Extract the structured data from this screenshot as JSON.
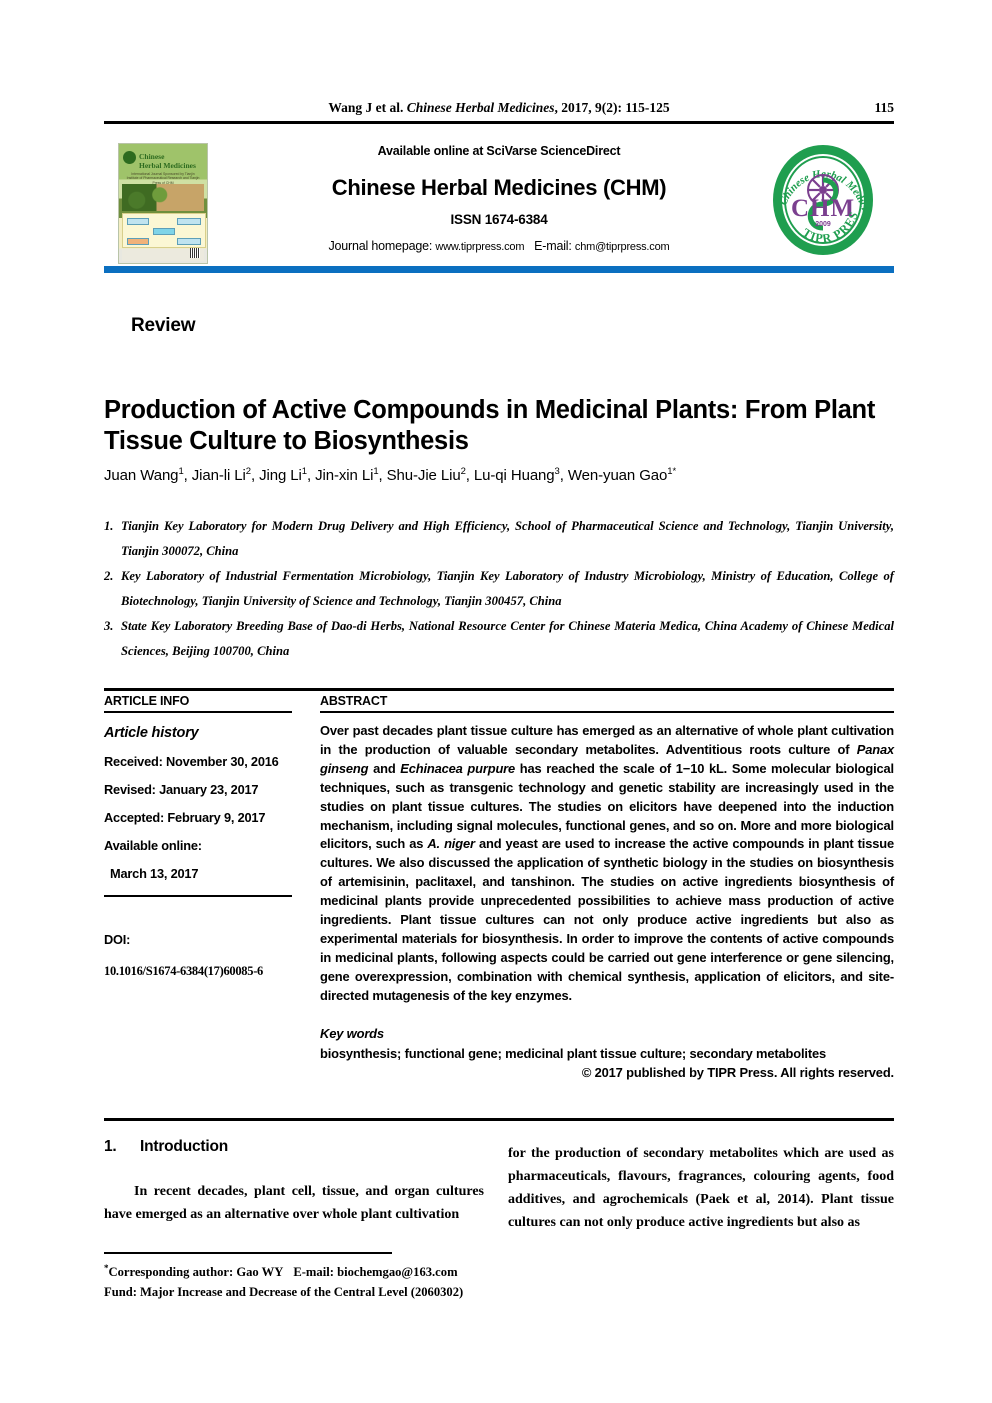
{
  "running_head": {
    "prefix": "Wang J et al. ",
    "journal_italic": "Chinese Herbal Medicines",
    "citation": ", 2017, 9(2): 115-125",
    "page_number": "115"
  },
  "masthead": {
    "available_online": "Available online at SciVarse ScienceDirect",
    "journal_name": "Chinese Herbal Medicines (CHM)",
    "issn": "ISSN 1674-6384",
    "homepage_label": "Journal homepage: ",
    "homepage_value": "www.tiprpress.com",
    "email_label": "E-mail: ",
    "email_value": "chm@tiprpress.com",
    "cover": {
      "title_line1": "Chinese",
      "title_line2": "Herbal Medicines",
      "subtitle": "International Journal Sponsored by Tianjin Institute of Pharmaceutical Research and Tianjin Press of CHM",
      "volume_line": "Vol 9  No.2  July 2017"
    },
    "logo": {
      "arc_top": "Chinese Herbal Medicines",
      "center_text": "CHM",
      "year": "2009",
      "arc_bottom": "TIPR PRESS",
      "brand_color": "#1f9e4f"
    },
    "accent_bar_color": "#0b6fc0"
  },
  "article_type": "Review",
  "title": "Production of Active Compounds in Medicinal Plants: From Plant Tissue Culture to Biosynthesis",
  "authors": [
    {
      "name": "Juan Wang",
      "sup": "1"
    },
    {
      "name": "Jian-li Li",
      "sup": "2"
    },
    {
      "name": "Jing Li",
      "sup": "1"
    },
    {
      "name": "Jin-xin Li",
      "sup": "1"
    },
    {
      "name": "Shu-Jie Liu",
      "sup": "2"
    },
    {
      "name": "Lu-qi Huang",
      "sup": "3"
    },
    {
      "name": "Wen-yuan Gao",
      "sup": "1*"
    }
  ],
  "affiliations": [
    {
      "num": "1.",
      "text": "Tianjin Key Laboratory for Modern Drug Delivery and High Efficiency, School of Pharmaceutical Science and Technology, Tianjin University, Tianjin 300072, China"
    },
    {
      "num": "2.",
      "text": "Key Laboratory of Industrial Fermentation Microbiology, Tianjin Key Laboratory of Industry Microbiology, Ministry of Education, College of Biotechnology, Tianjin University of Science and Technology, Tianjin 300457, China"
    },
    {
      "num": "3.",
      "text": "State Key Laboratory Breeding Base of Dao-di Herbs, National Resource Center for Chinese Materia Medica, China Academy of Chinese Medical Sciences, Beijing 100700, China"
    }
  ],
  "article_info": {
    "heading": "ARTICLE INFO",
    "history_title": "Article history",
    "received": "Received: November 30, 2016",
    "revised": "Revised: January 23, 2017",
    "accepted": "Accepted: February 9, 2017",
    "available_online_label": "Available online:",
    "available_online_date": "March 13, 2017",
    "doi_label": "DOI:",
    "doi_value": "10.1016/S1674-6384(17)60085-6"
  },
  "abstract": {
    "heading": "ABSTRACT",
    "p1_a": "Over past decades plant tissue culture has emerged as an alternative of whole plant cultivation in the production of valuable secondary metabolites. Adventitious roots culture of ",
    "p1_i1": "Panax ginseng",
    "p1_b": " and ",
    "p1_i2": "Echinacea purpure",
    "p1_c": " has reached the scale of 1−10 kL. Some molecular biological techniques, such as transgenic technology and genetic stability are increasingly used in the studies on plant tissue cultures. The studies on elicitors have deepened into the induction mechanism, including signal molecules, functional genes, and so on. More and more biological elicitors, such as ",
    "p1_i3": "A. niger",
    "p1_d": " and yeast are used to increase the active compounds in plant tissue cultures. We also discussed the application of synthetic biology in the studies on biosynthesis of artemisinin, paclitaxel, and tanshinon. The studies on active ingredients biosynthesis of medicinal plants provide unprecedented possibilities to achieve mass production of active ingredients. Plant tissue cultures can not only produce active ingredients but also as experimental materials for biosynthesis. In order to improve the contents of active compounds in medicinal plants, following aspects could be carried out gene interference or gene silencing, gene overexpression, combination with chemical synthesis, application of elicitors, and site-directed mutagenesis of the key enzymes.",
    "keywords_title": "Key words",
    "keywords": "biosynthesis; functional gene; medicinal plant tissue culture; secondary metabolites",
    "copyright": "© 2017 published by TIPR Press. All rights reserved."
  },
  "introduction": {
    "number": "1.",
    "heading": "Introduction",
    "left_paragraph": "In recent decades, plant cell, tissue, and organ cultures have emerged as an alternative over whole plant cultivation",
    "right_paragraph": "for the production of secondary metabolites which are used as pharmaceuticals, flavours, fragrances, colouring agents, food additives, and agrochemicals (Paek et al, 2014). Plant tissue cultures can not only produce active ingredients but also as"
  },
  "footnote": {
    "corresponding_label": "Corresponding author: ",
    "corresponding_name": "Gao WY",
    "email_label": "E-mail: ",
    "email_value": "biochemgao@163.com",
    "fund": "Fund: Major Increase and Decrease of the Central Level (2060302)"
  }
}
